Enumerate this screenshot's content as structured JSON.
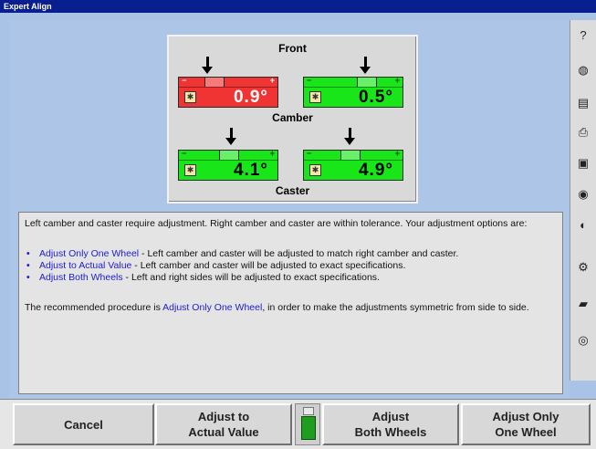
{
  "window": {
    "title": "Expert Align"
  },
  "gauges": {
    "front_label": "Front",
    "camber_label": "Camber",
    "caster_label": "Caster",
    "camber_left": {
      "value": "0.9°",
      "status": "out-of-tolerance",
      "color": "#f03434"
    },
    "camber_right": {
      "value": "0.5°",
      "status": "within-tolerance",
      "color": "#19e619"
    },
    "caster_left": {
      "value": "4.1°",
      "status": "within-tolerance",
      "color": "#19e619"
    },
    "caster_right": {
      "value": "4.9°",
      "status": "within-tolerance",
      "color": "#19e619"
    }
  },
  "message": {
    "intro": "Left camber and caster require adjustment.  Right camber and caster are within tolerance.  Your adjustment options are:",
    "options": [
      {
        "name": "Adjust Only One Wheel",
        "desc": " - Left camber and caster will be adjusted to match right camber and caster."
      },
      {
        "name": "Adjust to Actual Value",
        "desc": " - Left camber and caster will be adjusted to exact specifications."
      },
      {
        "name": "Adjust Both Wheels",
        "desc": " - Left and right sides will be adjusted to exact specifications."
      }
    ],
    "recommend_prefix": "The recommended procedure is ",
    "recommend_option": "Adjust Only One Wheel",
    "recommend_suffix": ", in order to make the adjustments symmetric from side to side."
  },
  "buttons": {
    "cancel": "Cancel",
    "actual_line1": "Adjust to",
    "actual_line2": "Actual Value",
    "both_line1": "Adjust",
    "both_line2": "Both Wheels",
    "one_line1": "Adjust Only",
    "one_line2": "One Wheel"
  },
  "toolbar_icons": [
    "help-icon",
    "globe-icon",
    "measure-icon",
    "printer-icon",
    "vehicle-icon",
    "camera-icon",
    "gauge-icon",
    "settings-icon",
    "car-icon",
    "cd-icon"
  ],
  "colors": {
    "accent_blue": "#1d1dcc",
    "title_bar": "#0a1f8f",
    "background": "#a9c3e6"
  }
}
